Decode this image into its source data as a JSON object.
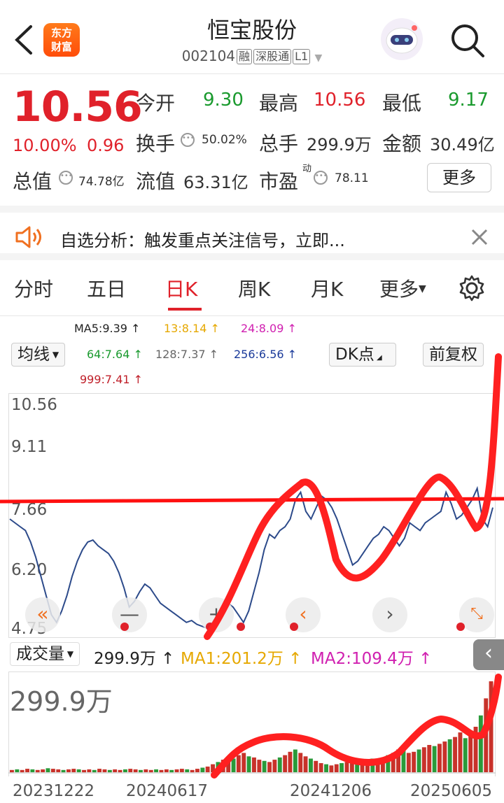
{
  "header": {
    "logo_lines": [
      "东方",
      "财富"
    ],
    "stock_name": "恒宝股份",
    "code": "002104",
    "tags": [
      "融",
      "深股通",
      "L1"
    ]
  },
  "quote": {
    "price": "10.56",
    "change_pct": "10.00%",
    "change": "0.96",
    "open_label": "今开",
    "open": "9.30",
    "high_label": "最高",
    "high": "10.56",
    "low_label": "最低",
    "low": "9.17",
    "turnover_label": "换手",
    "turnover": "50.02%",
    "volume_label": "总手",
    "volume": "299.9万",
    "amount_label": "金额",
    "amount": "30.49亿",
    "mcap_label": "总值",
    "mcap": "74.78亿",
    "float_label": "流值",
    "float": "63.31亿",
    "pe_label": "市盈",
    "pe_sup": "动",
    "pe": "78.11",
    "more_label": "更多"
  },
  "banner": {
    "text": "自选分析：触发重点关注信号，立即..."
  },
  "tabs": [
    "分时",
    "五日",
    "日K",
    "周K",
    "月K",
    "更多"
  ],
  "active_tab": "日K",
  "ma": {
    "selector": "均线",
    "ma5": "MA5:9.39 ↑",
    "ma13": "13:8.14 ↑",
    "ma24": "24:8.09 ↑",
    "ma64": "64:7.64 ↑",
    "ma128": "128:7.37 ↑",
    "ma256": "256:6.56 ↑",
    "ma999": "999:7.41 ↑",
    "dk_button": "DK点",
    "adjust_button": "前复权"
  },
  "chart_data": {
    "type": "line",
    "y_tick_labels": [
      "10.56",
      "9.11",
      "7.66",
      "6.20",
      "4.75"
    ],
    "ylim": [
      4.75,
      10.56
    ],
    "x_tick_labels": [
      "20231222",
      "20240617",
      "20241206",
      "20250605"
    ],
    "series": [
      {
        "values": [
          7.6,
          7.5,
          7.4,
          7.3,
          7.0,
          6.6,
          6.1,
          5.6,
          5.1,
          4.9,
          5.2,
          5.6,
          6.1,
          6.5,
          6.8,
          7.0,
          7.05,
          6.9,
          6.8,
          6.7,
          6.5,
          6.2,
          5.8,
          5.3,
          5.45,
          5.7,
          5.9,
          5.8,
          5.6,
          5.4,
          5.3,
          5.2,
          5.1,
          5.0,
          4.9,
          4.95,
          4.85,
          4.8,
          4.75,
          4.9,
          5.1,
          5.3,
          5.4,
          5.3,
          5.1,
          4.9,
          5.2,
          5.7,
          6.2,
          6.8,
          7.2,
          7.1,
          7.3,
          7.4,
          7.6,
          8.1,
          8.3,
          7.8,
          7.6,
          7.9,
          8.2,
          8.1,
          7.9,
          7.6,
          7.2,
          6.8,
          6.4,
          6.5,
          6.7,
          6.9,
          7.1,
          7.2,
          7.4,
          7.3,
          7.1,
          6.9,
          7.1,
          7.5,
          7.4,
          7.3,
          7.5,
          7.6,
          7.7,
          7.8,
          8.3,
          8.0,
          7.6,
          7.7,
          7.9,
          8.1,
          8.4,
          7.6,
          7.4,
          7.9
        ]
      }
    ]
  },
  "volume": {
    "selector": "成交量",
    "value": "299.9万 ↑",
    "ma1": "MA1:201.2万 ↑",
    "ma2": "MA2:109.4万 ↑",
    "big_label": "299.9万",
    "bars": [
      4,
      5,
      4,
      6,
      5,
      4,
      5,
      7,
      6,
      5,
      4,
      5,
      6,
      5,
      4,
      5,
      4,
      6,
      5,
      4,
      5,
      4,
      5,
      6,
      5,
      4,
      5,
      4,
      5,
      4,
      5,
      4,
      5,
      6,
      5,
      4,
      6,
      8,
      10,
      14,
      18,
      22,
      26,
      24,
      30,
      34,
      28,
      26,
      22,
      20,
      18,
      22,
      26,
      30,
      36,
      40,
      34,
      28,
      24,
      20,
      16,
      14,
      12,
      14,
      16,
      18,
      16,
      14,
      16,
      20,
      24,
      22,
      26,
      30,
      34,
      40,
      38,
      34,
      36,
      40,
      44,
      48,
      46,
      50,
      54,
      58,
      62,
      70,
      60,
      66,
      80,
      100,
      130,
      160
    ]
  }
}
